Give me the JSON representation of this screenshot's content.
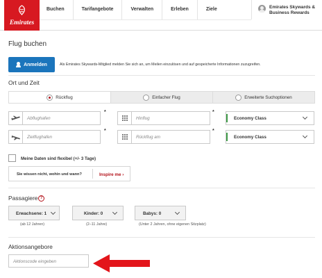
{
  "header": {
    "logo_text": "Emirates",
    "nav": [
      "Buchen",
      "Tarifangebote",
      "Verwalten",
      "Erleben",
      "Ziele"
    ],
    "account_line1": "Emirates Skywards &",
    "account_line2": "Business Rewards"
  },
  "page_title": "Flug buchen",
  "login": {
    "button_label": "Anmelden",
    "text": "Als Emirates Skywards-Mitglied melden Sie sich an, um Meilen einzulösen und auf gespeicherte Informationen zuzugreifen."
  },
  "route_section": {
    "title": "Ort und Zeit",
    "trip_types": [
      "Rückflug",
      "Einfacher Flug",
      "Erweiterte Suchoptionen"
    ],
    "selected_trip_type": "Rückflug",
    "departure_placeholder": "Abflughafen",
    "destination_placeholder": "Zielflughafen",
    "outbound_date_placeholder": "Hinflug",
    "return_date_placeholder": "Rückflug am",
    "required_mark": "*",
    "cabin_class_1": "Economy Class",
    "cabin_class_2": "Economy Class"
  },
  "flexible": {
    "label": "Meine Daten sind flexibel (+/- 3 Tage)",
    "checked": false
  },
  "inspire": {
    "text": "Sie wissen nicht, wohin und wann?",
    "link": "Inspire me ›"
  },
  "passengers": {
    "title": "Passagiere",
    "help": "?",
    "adults": {
      "label": "Erwachsene: 1",
      "note": "(ab 12 Jahren)"
    },
    "children": {
      "label": "Kinder: 0",
      "note": "(2–11 Jahre)"
    },
    "babies": {
      "label": "Babys: 0",
      "note": "(Unter 2 Jahren, ohne eigenen Sitzplatz)"
    }
  },
  "promo": {
    "title": "Aktionsangebore",
    "placeholder": "Aktionscode eingeben"
  },
  "colors": {
    "brand_red": "#d71921",
    "login_blue": "#1b75bc",
    "accent_green": "#3f9b48"
  }
}
